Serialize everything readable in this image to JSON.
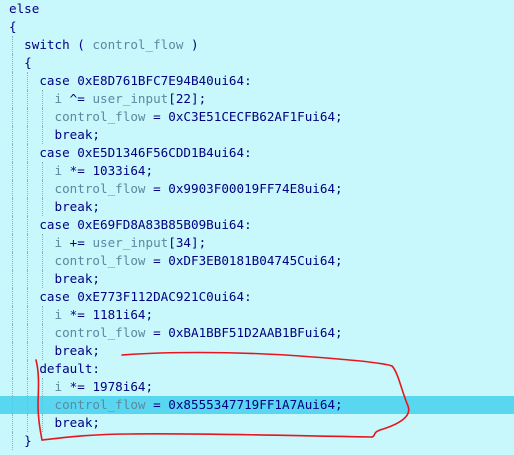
{
  "editor": {
    "lines": [
      {
        "indent": 0,
        "tokens": [
          {
            "t": "else",
            "c": "kw"
          }
        ]
      },
      {
        "indent": 0,
        "tokens": [
          {
            "t": "{",
            "c": "pun"
          }
        ]
      },
      {
        "indent": 1,
        "tokens": [
          {
            "t": "switch",
            "c": "kw"
          },
          {
            "t": " ( ",
            "c": "pun"
          },
          {
            "t": "control_flow",
            "c": "var"
          },
          {
            "t": " )",
            "c": "pun"
          }
        ]
      },
      {
        "indent": 1,
        "tokens": [
          {
            "t": "{",
            "c": "pun"
          }
        ]
      },
      {
        "indent": 2,
        "tokens": [
          {
            "t": "case ",
            "c": "kw"
          },
          {
            "t": "0xE8D761BFC7E94B40ui64",
            "c": "num"
          },
          {
            "t": ":",
            "c": "pun"
          }
        ]
      },
      {
        "indent": 3,
        "tokens": [
          {
            "t": "i",
            "c": "var"
          },
          {
            "t": " ^= ",
            "c": "pun"
          },
          {
            "t": "user_input",
            "c": "var"
          },
          {
            "t": "[22];",
            "c": "pun"
          }
        ]
      },
      {
        "indent": 3,
        "tokens": [
          {
            "t": "control_flow",
            "c": "var"
          },
          {
            "t": " = ",
            "c": "pun"
          },
          {
            "t": "0xC3E51CECFB62AF1Fui64;",
            "c": "num"
          }
        ]
      },
      {
        "indent": 3,
        "tokens": [
          {
            "t": "break;",
            "c": "kw"
          }
        ]
      },
      {
        "indent": 2,
        "tokens": [
          {
            "t": "case ",
            "c": "kw"
          },
          {
            "t": "0xE5D1346F56CDD1B4ui64",
            "c": "num"
          },
          {
            "t": ":",
            "c": "pun"
          }
        ]
      },
      {
        "indent": 3,
        "tokens": [
          {
            "t": "i",
            "c": "var"
          },
          {
            "t": " *= ",
            "c": "pun"
          },
          {
            "t": "1033i64;",
            "c": "num"
          }
        ]
      },
      {
        "indent": 3,
        "tokens": [
          {
            "t": "control_flow",
            "c": "var"
          },
          {
            "t": " = ",
            "c": "pun"
          },
          {
            "t": "0x9903F00019FF74E8ui64;",
            "c": "num"
          }
        ]
      },
      {
        "indent": 3,
        "tokens": [
          {
            "t": "break;",
            "c": "kw"
          }
        ]
      },
      {
        "indent": 2,
        "tokens": [
          {
            "t": "case ",
            "c": "kw"
          },
          {
            "t": "0xE69FD8A83B85B09Bui64",
            "c": "num"
          },
          {
            "t": ":",
            "c": "pun"
          }
        ]
      },
      {
        "indent": 3,
        "tokens": [
          {
            "t": "i",
            "c": "var"
          },
          {
            "t": " += ",
            "c": "pun"
          },
          {
            "t": "user_input",
            "c": "var"
          },
          {
            "t": "[34];",
            "c": "pun"
          }
        ]
      },
      {
        "indent": 3,
        "tokens": [
          {
            "t": "control_flow",
            "c": "var"
          },
          {
            "t": " = ",
            "c": "pun"
          },
          {
            "t": "0xDF3EB0181B04745Cui64;",
            "c": "num"
          }
        ]
      },
      {
        "indent": 3,
        "tokens": [
          {
            "t": "break;",
            "c": "kw"
          }
        ]
      },
      {
        "indent": 2,
        "tokens": [
          {
            "t": "case ",
            "c": "kw"
          },
          {
            "t": "0xE773F112DAC921C0ui64",
            "c": "num"
          },
          {
            "t": ":",
            "c": "pun"
          }
        ]
      },
      {
        "indent": 3,
        "tokens": [
          {
            "t": "i",
            "c": "var"
          },
          {
            "t": " *= ",
            "c": "pun"
          },
          {
            "t": "1181i64;",
            "c": "num"
          }
        ]
      },
      {
        "indent": 3,
        "tokens": [
          {
            "t": "control_flow",
            "c": "var"
          },
          {
            "t": " = ",
            "c": "pun"
          },
          {
            "t": "0xBA1BBF51D2AAB1BFui64;",
            "c": "num"
          }
        ]
      },
      {
        "indent": 3,
        "tokens": [
          {
            "t": "break;",
            "c": "kw"
          }
        ]
      },
      {
        "indent": 2,
        "tokens": [
          {
            "t": "default:",
            "c": "kw"
          }
        ]
      },
      {
        "indent": 3,
        "tokens": [
          {
            "t": "i",
            "c": "var"
          },
          {
            "t": " *= ",
            "c": "pun"
          },
          {
            "t": "1978i64;",
            "c": "num"
          }
        ]
      },
      {
        "indent": 3,
        "highlighted": true,
        "tokens": [
          {
            "t": "control_flow",
            "c": "var"
          },
          {
            "t": " = ",
            "c": "pun"
          },
          {
            "t": "0x8555347719FF1A7Aui64;",
            "c": "num"
          }
        ]
      },
      {
        "indent": 3,
        "tokens": [
          {
            "t": "break;",
            "c": "kw"
          }
        ]
      },
      {
        "indent": 1,
        "tokens": [
          {
            "t": "}",
            "c": "pun"
          }
        ]
      }
    ]
  },
  "colors": {
    "background": "#c8f8fc",
    "highlight": "#5ad7f0",
    "text": "#000080",
    "variable": "#5a8aa0",
    "annotation": "#e8161c"
  }
}
